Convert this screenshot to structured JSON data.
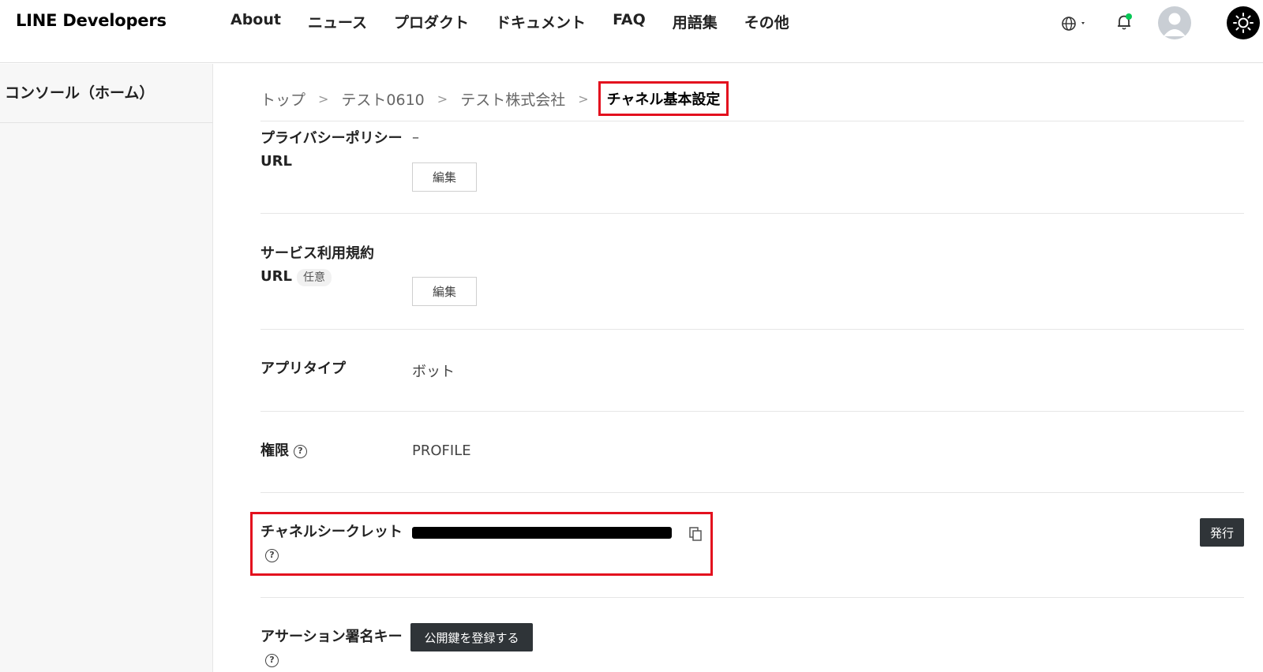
{
  "header": {
    "logo": "LINE Developers",
    "nav": [
      {
        "label": "About"
      },
      {
        "label": "ニュース"
      },
      {
        "label": "プロダクト"
      },
      {
        "label": "ドキュメント"
      },
      {
        "label": "FAQ"
      },
      {
        "label": "用語集"
      },
      {
        "label": "その他"
      }
    ],
    "icons": [
      "globe-icon",
      "bell-icon",
      "avatar",
      "sun-icon"
    ],
    "notification_dot_color": "#06c755"
  },
  "sidebar": {
    "items": [
      {
        "label": "コンソール（ホーム）"
      }
    ]
  },
  "breadcrumb": {
    "items": [
      "トップ",
      "テスト0610",
      "テスト株式会社"
    ],
    "separator": ">",
    "current": "チャネル基本設定"
  },
  "settings": {
    "privacy_policy": {
      "label": "プライバシーポリシーURL",
      "value": "–",
      "edit_label": "編集"
    },
    "terms_of_use": {
      "label": "サービス利用規約URL",
      "badge": "任意",
      "edit_label": "編集"
    },
    "app_type": {
      "label": "アプリタイプ",
      "value": "ボット"
    },
    "permissions": {
      "label": "権限",
      "value": "PROFILE",
      "help": "?"
    },
    "channel_secret": {
      "label": "チャネルシークレット",
      "help": "?",
      "issue_label": "発行"
    },
    "assertion_key": {
      "label": "アサーション署名キー",
      "help": "?",
      "register_label": "公開鍵を登録する"
    }
  },
  "colors": {
    "highlight": "#e3101e",
    "dark_button": "#2f3438"
  }
}
